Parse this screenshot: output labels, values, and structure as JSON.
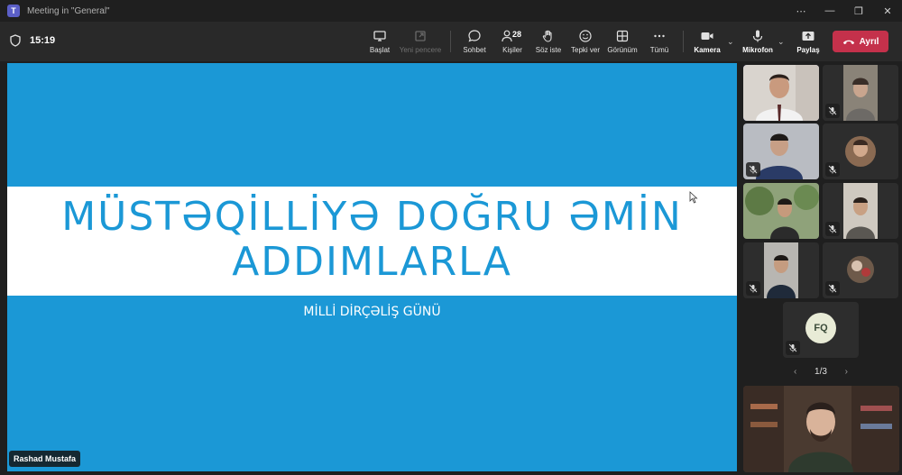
{
  "window": {
    "title": "Meeting in \"General\"",
    "app_icon": "teams-icon"
  },
  "toolbar": {
    "timer": "15:19",
    "buttons": [
      {
        "id": "start",
        "label": "Başlat",
        "icon": "present-icon",
        "enabled": true
      },
      {
        "id": "new_window",
        "label": "Yeni pencere",
        "icon": "popout-icon",
        "enabled": false
      },
      {
        "id": "chat",
        "label": "Sohbet",
        "icon": "chat-icon",
        "enabled": true
      },
      {
        "id": "people",
        "label": "Kişiler",
        "icon": "people-icon",
        "enabled": true,
        "count": "28"
      },
      {
        "id": "raise_hand",
        "label": "Söz iste",
        "icon": "hand-icon",
        "enabled": true
      },
      {
        "id": "react",
        "label": "Tepki ver",
        "icon": "smiley-icon",
        "enabled": true
      },
      {
        "id": "view",
        "label": "Görünüm",
        "icon": "grid-icon",
        "enabled": true
      },
      {
        "id": "more",
        "label": "Tümü",
        "icon": "more-icon",
        "enabled": true
      },
      {
        "id": "camera",
        "label": "Kamera",
        "icon": "camera-icon",
        "enabled": true
      },
      {
        "id": "mic",
        "label": "Mikrofon",
        "icon": "mic-icon",
        "enabled": true
      },
      {
        "id": "share",
        "label": "Paylaş",
        "icon": "share-icon",
        "enabled": true
      }
    ],
    "leave_label": "Ayrıl",
    "leave_color": "#c4314b"
  },
  "stage": {
    "slide": {
      "title_line1": "MÜSTƏQİLLİYƏ DOĞRU ƏMİN",
      "title_line2": "ADDIMLARLA",
      "subtitle": "MİLLİ DİRÇƏLİŞ GÜNÜ",
      "background_color": "#1b98d6",
      "band_color": "#ffffff"
    },
    "presenter_name": "Rashad Mustafa"
  },
  "participants": {
    "tiles": [
      {
        "kind": "video",
        "muted": false,
        "active": true
      },
      {
        "kind": "video",
        "muted": true
      },
      {
        "kind": "video",
        "muted": true
      },
      {
        "kind": "video",
        "muted": true
      },
      {
        "kind": "video",
        "muted": false
      },
      {
        "kind": "video",
        "muted": true
      },
      {
        "kind": "video",
        "muted": true
      },
      {
        "kind": "video",
        "muted": true
      },
      {
        "kind": "avatar",
        "initials": "FQ",
        "muted": true
      }
    ],
    "pager": "1/3"
  },
  "self_view": {
    "kind": "video"
  }
}
